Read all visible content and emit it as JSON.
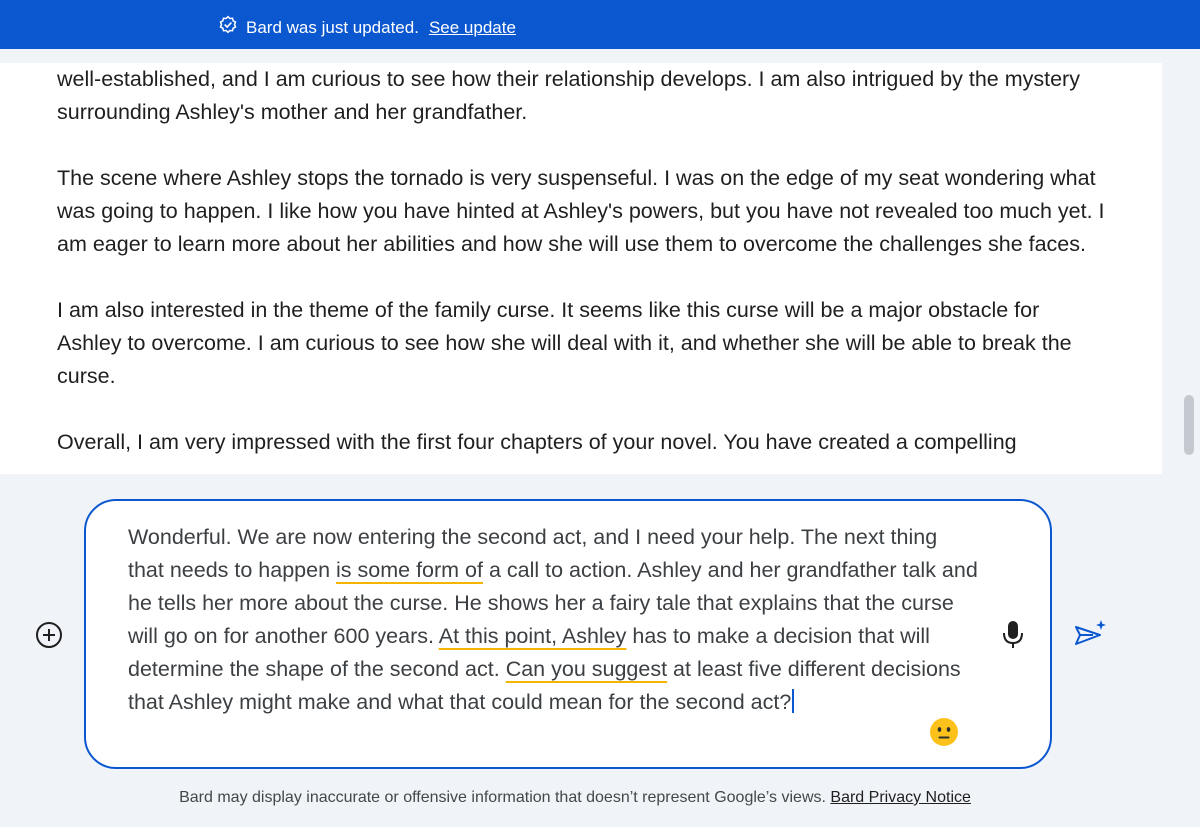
{
  "banner": {
    "text": "Bard was just updated.",
    "link": "See update"
  },
  "response": {
    "paragraphs": [
      "well-established, and I am curious to see how their relationship develops. I am also intrigued by the mystery surrounding Ashley's mother and her grandfather.",
      "The scene where Ashley stops the tornado is very suspenseful. I was on the edge of my seat wondering what was going to happen. I like how you have hinted at Ashley's powers, but you have not revealed too much yet. I am eager to learn more about her abilities and how she will use them to overcome the challenges she faces.",
      "I am also interested in the theme of the family curse. It seems like this curse will be a major obstacle for Ashley to overcome. I am curious to see how she will deal with it, and whether she will be able to break the curse.",
      "Overall, I am very impressed with the first four chapters of your novel. You have created a compelling"
    ]
  },
  "prompt": {
    "segments": [
      "Wonderful. We are now entering the second act, and I need your help. The next thing that needs to happen ",
      "is some form of",
      " a call to action. Ashley and her grandfather talk and he tells her more about the curse. He shows her a fairy tale that explains that the curse will go on for another 600 years. ",
      "At this point, Ashley",
      " has to make a decision that will determine the shape of the second act. ",
      "Can you suggest",
      " at least five different decisions that Ashley might make and what that could mean for the second act?"
    ]
  },
  "icons": {
    "banner": "check-badge-icon",
    "add": "add-circle-icon",
    "mic": "microphone-icon",
    "send": "send-sparkle-icon",
    "emoji": "neutral-face-emoji-icon"
  },
  "disclaimer": {
    "text": "Bard may display inaccurate or offensive information that doesn’t represent Google’s views.",
    "link": "Bard Privacy Notice"
  },
  "colors": {
    "banner_bg": "#0b57d0",
    "page_bg": "#f0f4f9",
    "input_border": "#0b57d0",
    "grammar_underline": "#f4b400",
    "send_icon": "#0b57d0"
  }
}
